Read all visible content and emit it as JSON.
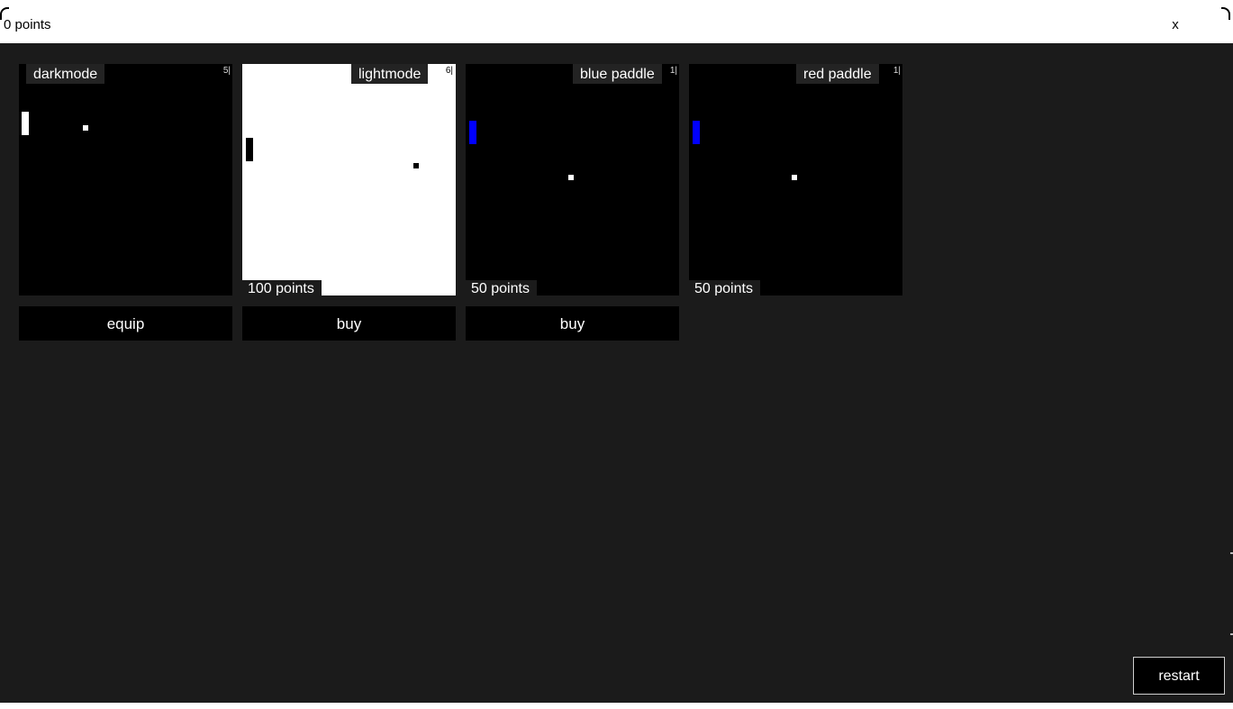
{
  "window": {
    "title": "0 points",
    "close_label": "x"
  },
  "shop": {
    "items": [
      {
        "name": "darkmode",
        "count": "5|",
        "price": "",
        "action": "equip",
        "background": "#000000",
        "paddle_color": "#ffffff",
        "ball_color": "#ffffff"
      },
      {
        "name": "lightmode",
        "count": "6|",
        "price": "100 points",
        "action": "buy",
        "background": "#ffffff",
        "paddle_color": "#000000",
        "ball_color": "#000000"
      },
      {
        "name": "blue paddle",
        "count": "1|",
        "price": "50 points",
        "action": "buy",
        "background": "#000000",
        "paddle_color": "#0000ff",
        "ball_color": "#ffffff"
      },
      {
        "name": "red paddle",
        "count": "1|",
        "price": "50 points",
        "action": "",
        "background": "#000000",
        "paddle_color": "#0000ff",
        "ball_color": "#ffffff"
      }
    ]
  },
  "footer": {
    "restart_label": "restart"
  },
  "colors": {
    "panel_background": "#1b1b1b",
    "card_dark": "#000000",
    "card_light": "#ffffff",
    "blue_paddle": "#0000ff",
    "text": "#ffffff"
  }
}
